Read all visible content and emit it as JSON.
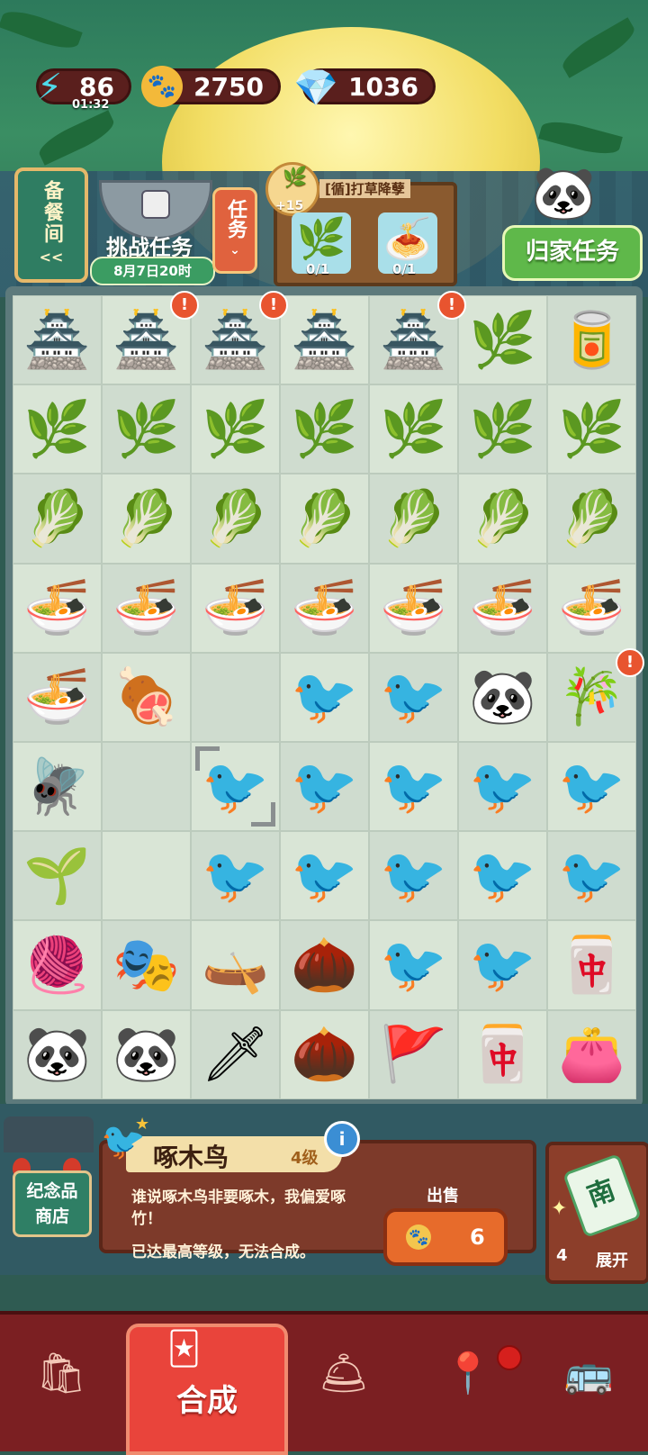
{
  "resources": {
    "energy": {
      "icon": "lightning-icon",
      "value": "86",
      "timer": "01:32"
    },
    "coins": {
      "icon": "paw-coin-icon",
      "value": "2750"
    },
    "gems": {
      "icon": "gem-icon",
      "value": "1036"
    }
  },
  "left_panel": {
    "pantry_label": "备餐间",
    "pantry_arrow": "<<",
    "challenge_label": "挑战任务",
    "challenge_date": "8月7日20时",
    "task_button": "任务"
  },
  "task_board": {
    "bonus": "+15",
    "title": "[循]打草降孽",
    "slots": [
      {
        "icon": "leaves-icon",
        "progress": "0/1"
      },
      {
        "icon": "noodles-icon",
        "progress": "0/1"
      }
    ]
  },
  "home_task": {
    "label": "归家任务"
  },
  "grid": {
    "rows": [
      [
        {
          "icon": "🏯",
          "name": "pavilion",
          "alert": false
        },
        {
          "icon": "🏯",
          "name": "pavilion",
          "alert": true
        },
        {
          "icon": "🏯",
          "name": "pavilion",
          "alert": true
        },
        {
          "icon": "🏯",
          "name": "pavilion",
          "alert": false
        },
        {
          "icon": "🏯",
          "name": "pavilion",
          "alert": true
        },
        {
          "icon": "🌿",
          "name": "leaves-dustpan",
          "alert": false
        },
        {
          "icon": "🥫",
          "name": "round-box",
          "alert": false
        }
      ],
      [
        {
          "icon": "🌿",
          "name": "leaves-dustpan",
          "alert": false
        },
        {
          "icon": "🌿",
          "name": "leaves-dustpan",
          "alert": false
        },
        {
          "icon": "🌿",
          "name": "leaves-dustpan",
          "alert": false
        },
        {
          "icon": "🌿",
          "name": "leaves-dustpan",
          "alert": false
        },
        {
          "icon": "🌿",
          "name": "leaves-dustpan",
          "alert": false
        },
        {
          "icon": "🌿",
          "name": "leaves-dustpan",
          "alert": false
        },
        {
          "icon": "🌿",
          "name": "leaves-dustpan",
          "alert": false
        }
      ],
      [
        {
          "icon": "🥬",
          "name": "leaves-basket",
          "alert": false
        },
        {
          "icon": "🥬",
          "name": "leaves-basket",
          "alert": false
        },
        {
          "icon": "🥬",
          "name": "leaves-basket",
          "alert": false
        },
        {
          "icon": "🥬",
          "name": "leaves-basket",
          "alert": false
        },
        {
          "icon": "🥬",
          "name": "leaves-basket",
          "alert": false
        },
        {
          "icon": "🥬",
          "name": "leaves-basket",
          "alert": false
        },
        {
          "icon": "🥬",
          "name": "leaves-basket",
          "alert": false
        }
      ],
      [
        {
          "icon": "🍜",
          "name": "hotpot-bowl",
          "alert": false
        },
        {
          "icon": "🍜",
          "name": "hotpot-bowl",
          "alert": false
        },
        {
          "icon": "🍜",
          "name": "hotpot-bowl",
          "alert": false
        },
        {
          "icon": "🍜",
          "name": "hotpot-bowl",
          "alert": false
        },
        {
          "icon": "🍜",
          "name": "hotpot-bowl",
          "alert": false
        },
        {
          "icon": "🍜",
          "name": "hotpot-bowl",
          "alert": false
        },
        {
          "icon": "🍜",
          "name": "hotpot-bowl",
          "alert": false
        }
      ],
      [
        {
          "icon": "🍜",
          "name": "hotpot-bowl",
          "alert": false
        },
        {
          "icon": "🍖",
          "name": "meatball-plate",
          "alert": false
        },
        {
          "icon": "",
          "name": "empty",
          "alert": false
        },
        {
          "icon": "🐦",
          "name": "woodpecker",
          "alert": false
        },
        {
          "icon": "🐦",
          "name": "woodpecker",
          "alert": false
        },
        {
          "icon": "🐼",
          "name": "panda-frame",
          "alert": false
        },
        {
          "icon": "🎋",
          "name": "bamboo",
          "alert": true
        }
      ],
      [
        {
          "icon": "🪰",
          "name": "dragonfly",
          "alert": false
        },
        {
          "icon": "",
          "name": "empty",
          "alert": false
        },
        {
          "icon": "🐦",
          "name": "woodpecker-selected",
          "alert": false
        },
        {
          "icon": "🐦",
          "name": "woodpecker",
          "alert": false
        },
        {
          "icon": "🐦",
          "name": "woodpecker",
          "alert": false
        },
        {
          "icon": "🐦",
          "name": "woodpecker",
          "alert": false
        },
        {
          "icon": "🐦",
          "name": "woodpecker",
          "alert": false
        }
      ],
      [
        {
          "icon": "🌱",
          "name": "tea-box",
          "alert": false
        },
        {
          "icon": "",
          "name": "empty",
          "alert": false
        },
        {
          "icon": "🐦",
          "name": "woodpecker",
          "alert": false
        },
        {
          "icon": "🐦",
          "name": "woodpecker",
          "alert": false
        },
        {
          "icon": "🐦",
          "name": "woodpecker",
          "alert": false
        },
        {
          "icon": "🐦",
          "name": "woodpecker",
          "alert": false
        },
        {
          "icon": "🐦",
          "name": "woodpecker",
          "alert": false
        }
      ],
      [
        {
          "icon": "🧶",
          "name": "sewing-kit",
          "alert": false
        },
        {
          "icon": "🎭",
          "name": "opera-panda",
          "alert": false
        },
        {
          "icon": "🛶",
          "name": "boat",
          "alert": false
        },
        {
          "icon": "🌰",
          "name": "seed",
          "alert": false
        },
        {
          "icon": "🐦",
          "name": "woodpecker",
          "alert": false
        },
        {
          "icon": "🐦",
          "name": "woodpecker",
          "alert": false
        },
        {
          "icon": "🀄",
          "name": "mahjong-tile",
          "alert": false
        }
      ],
      [
        {
          "icon": "🐼",
          "name": "red-panda",
          "alert": false
        },
        {
          "icon": "🐼",
          "name": "panda-waiter",
          "alert": false
        },
        {
          "icon": "🗡",
          "name": "blade",
          "alert": false
        },
        {
          "icon": "🌰",
          "name": "seeds",
          "alert": false
        },
        {
          "icon": "🚩",
          "name": "flag",
          "alert": false
        },
        {
          "icon": "🀄",
          "name": "mahjong-table",
          "alert": false
        },
        {
          "icon": "👛",
          "name": "pouch",
          "alert": false
        }
      ]
    ]
  },
  "shop": {
    "label_line1": "纪念品",
    "label_line2": "商店"
  },
  "item_info": {
    "name": "啄木鸟",
    "level": "4级",
    "description": "谁说啄木鸟非要啄木，我偏爱啄竹！",
    "note": "已达最高等级，无法合成。",
    "sell_label": "出售",
    "sell_price": "6"
  },
  "expand": {
    "count": "4",
    "label": "展开",
    "tile_char": "南"
  },
  "nav": {
    "items": [
      {
        "icon": "bag-icon",
        "glyph": "🛍"
      },
      {
        "icon": "merge-icon",
        "glyph": "🃏",
        "label": "合成"
      },
      {
        "icon": "cloche-icon",
        "glyph": "🛎"
      },
      {
        "icon": "map-pin-icon",
        "glyph": "📍"
      },
      {
        "icon": "bus-icon",
        "glyph": "🚌"
      }
    ]
  }
}
